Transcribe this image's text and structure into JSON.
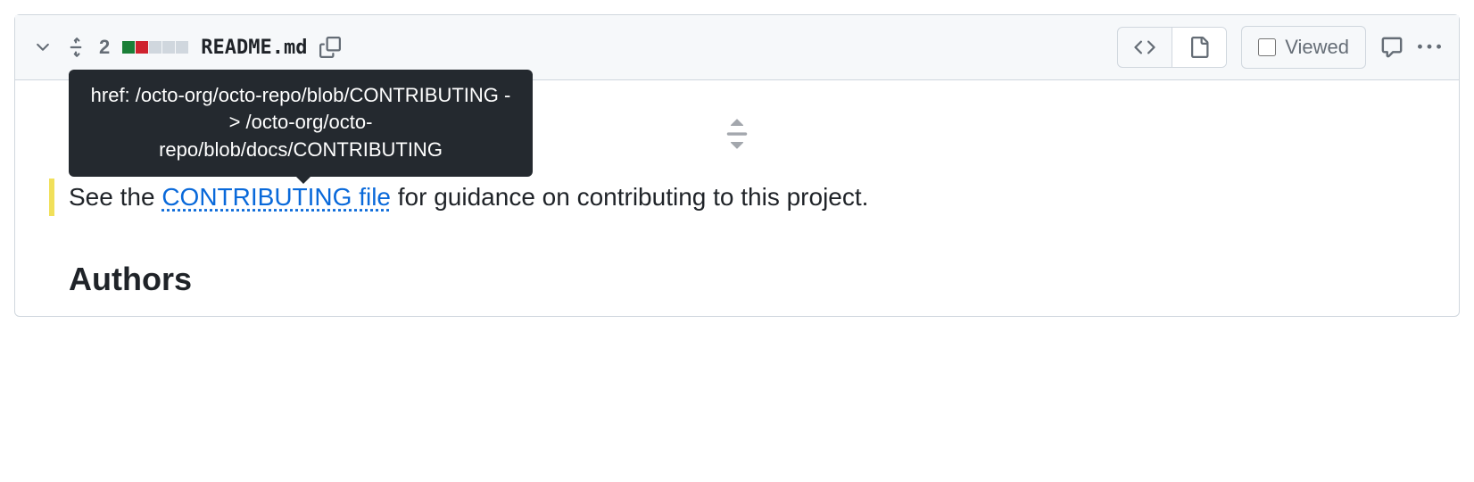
{
  "file": {
    "change_count": "2",
    "filename": "README.md",
    "diff_blocks": [
      "added",
      "removed",
      "neutral",
      "neutral",
      "neutral"
    ]
  },
  "toolbar": {
    "viewed_label": "Viewed"
  },
  "tooltip": {
    "text": "href: /octo-org/octo-repo/blob/CONTRIBUTING -> /octo-org/octo-repo/blob/docs/CONTRIBUTING"
  },
  "content": {
    "text_before": "See the ",
    "link_text": "CONTRIBUTING file",
    "text_after": " for guidance on contributing to this project."
  },
  "heading": "Authors"
}
